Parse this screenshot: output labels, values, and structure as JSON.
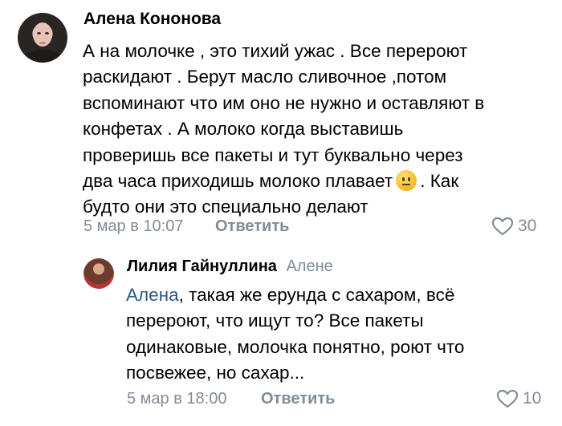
{
  "comment": {
    "author": "Алена Кононова",
    "lines": [
      "А на молочке , это тихий ужас . Все перероют",
      "раскидают . Берут масло сливочное ,потом",
      "вспоминают что им оно не нужно и оставляют в",
      "конфетах . А молоко когда выставишь",
      "проверишь все пакеты и тут буквально через"
    ],
    "line6_before": "два часа приходишь молоко плавает",
    "line6_after": ". Как",
    "line7": "будто они это специально делают",
    "emoji": "neutral-face-icon",
    "date": "5 мар в 10:07",
    "reply_label": "Ответить",
    "likes": "30"
  },
  "reply": {
    "author": "Лилия Гайнуллина",
    "to": "Алене",
    "mention": "Алена",
    "line1_rest": ", такая же ерунда с сахаром, всё",
    "lines": [
      "перероют, что ищут то? Все пакеты",
      "одинаковые, молочка понятно, роют что",
      "посвежее, но сахар..."
    ],
    "date": "5 мар в 18:00",
    "reply_label": "Ответить",
    "likes": "10"
  },
  "colors": {
    "meta": "#818c99",
    "link": "#2a5885",
    "text": "#000000"
  }
}
